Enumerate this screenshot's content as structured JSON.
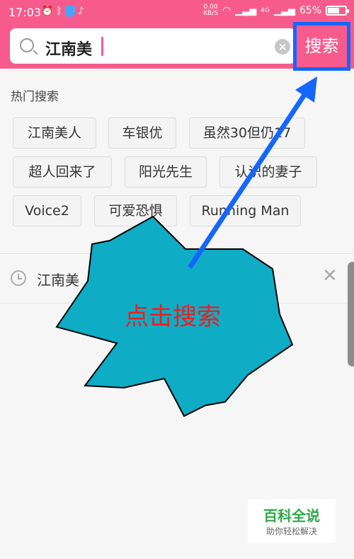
{
  "status_bar": {
    "time": "17:03",
    "speed_value": "0.00",
    "speed_unit": "KB/S",
    "network_label": "4G",
    "battery_text": "65%",
    "battery_level": 0.65
  },
  "search": {
    "query": "江南美",
    "button_label": "搜索"
  },
  "hot_search": {
    "title": "热门搜索",
    "tags": [
      "江南美人",
      "车银优",
      "虽然30但仍17",
      "超人回来了",
      "阳光先生",
      "认识的妻子",
      "Voice2",
      "可爱恐惧",
      "Running Man"
    ]
  },
  "history": {
    "items": [
      {
        "text": "江南美"
      }
    ]
  },
  "annotation": {
    "label": "点击搜索",
    "arrow_color": "#1565ff",
    "burst_color": "#0eacc5",
    "text_color": "#ee1d1d"
  },
  "watermark": {
    "brand": "百科全说",
    "slogan": "助你轻松解决"
  },
  "colors": {
    "header": "#f75b8d",
    "highlight_box": "#1565ff"
  }
}
